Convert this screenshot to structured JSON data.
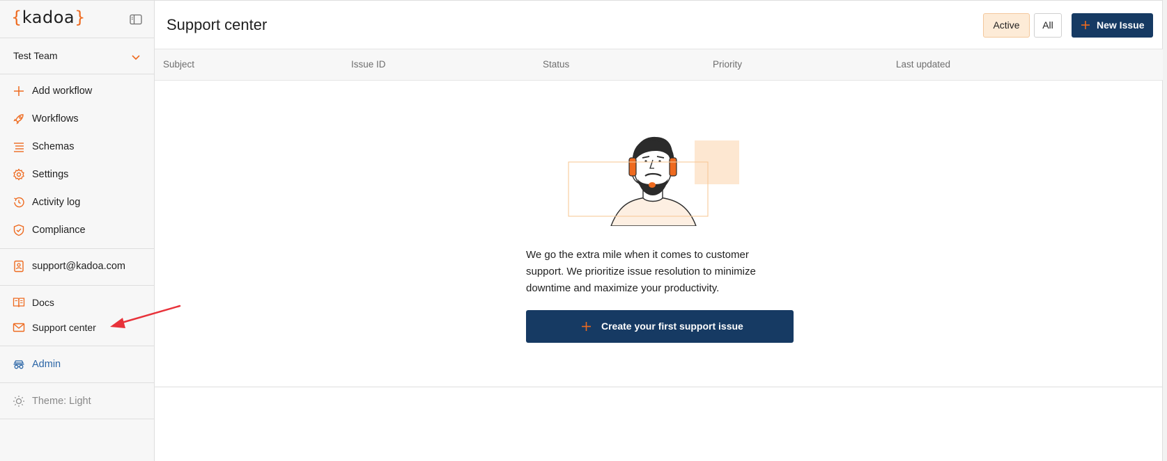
{
  "brand": {
    "left_brace": "{",
    "word": "kadoa",
    "right_brace": "}"
  },
  "team": {
    "label": "Test Team"
  },
  "sidebar": {
    "main_items": [
      {
        "label": "Add workflow",
        "icon": "plus-icon"
      },
      {
        "label": "Workflows",
        "icon": "rocket-icon"
      },
      {
        "label": "Schemas",
        "icon": "list-icon"
      },
      {
        "label": "Settings",
        "icon": "gear-icon"
      },
      {
        "label": "Activity log",
        "icon": "clock-icon"
      },
      {
        "label": "Compliance",
        "icon": "shield-icon"
      }
    ],
    "contact": {
      "label": "support@kadoa.com",
      "icon": "contact-card-icon"
    },
    "help_items": [
      {
        "label": "Docs",
        "icon": "book-icon"
      },
      {
        "label": "Support center",
        "icon": "mail-icon"
      }
    ],
    "admin": {
      "label": "Admin",
      "icon": "admin-icon"
    },
    "theme": {
      "label": "Theme: Light",
      "icon": "sun-icon"
    }
  },
  "header": {
    "title": "Support center",
    "filter_active": "Active",
    "filter_all": "All",
    "new_issue": "New Issue"
  },
  "table": {
    "columns": [
      "Subject",
      "Issue ID",
      "Status",
      "Priority",
      "Last updated"
    ]
  },
  "empty_state": {
    "lines": [
      "We go the extra mile when it comes to customer",
      "support. We prioritize issue resolution to minimize",
      "downtime and maximize your productivity."
    ],
    "button": "Create your first support issue"
  },
  "colors": {
    "accent": "#ee6a1f",
    "primary": "#163a63",
    "active_bg": "#fdebd7",
    "admin_blue": "#2a65a6",
    "annotation": "#e8323a"
  }
}
